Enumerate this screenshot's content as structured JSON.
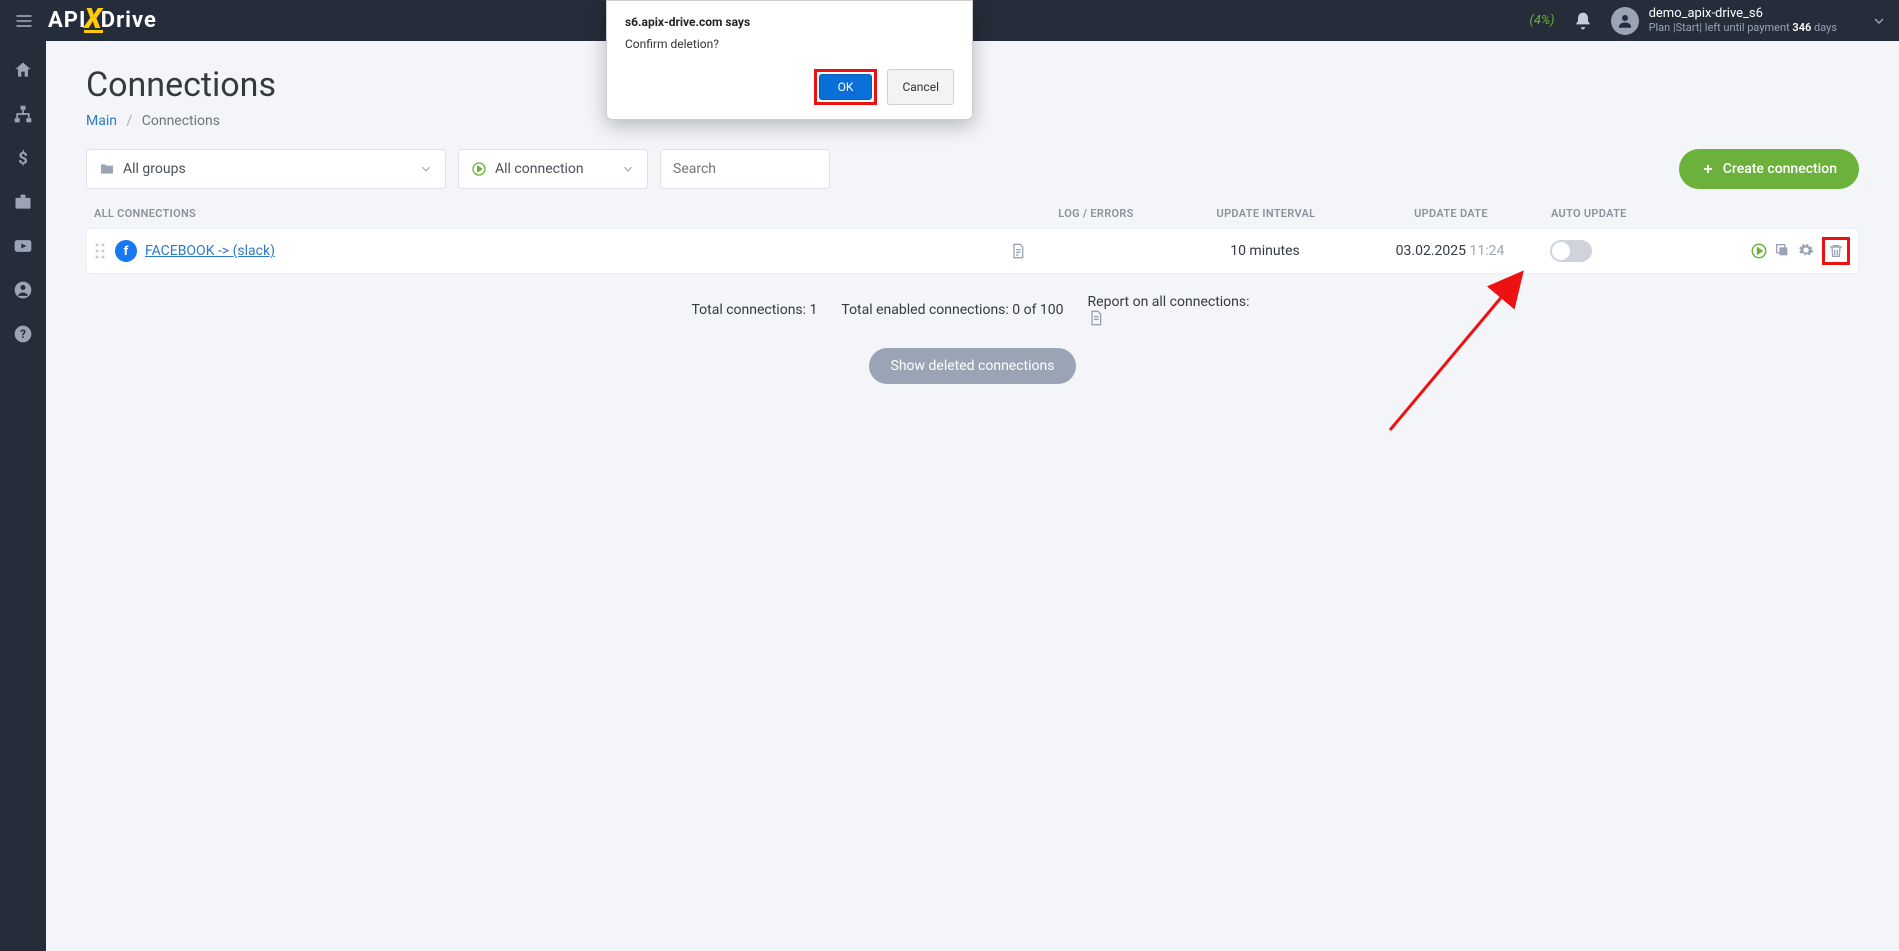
{
  "logo": {
    "part1": "API",
    "part2": "X",
    "part3": "Drive"
  },
  "header": {
    "percent_text": "(4%)",
    "user_name": "demo_apix-drive_s6",
    "plan_prefix": "Plan |Start| left until payment ",
    "plan_days": "346",
    "plan_suffix": " days"
  },
  "page": {
    "title": "Connections",
    "breadcrumb_main": "Main",
    "breadcrumb_current": "Connections"
  },
  "filters": {
    "groups_label": "All groups",
    "status_label": "All connection",
    "search_placeholder": "Search",
    "create_label": "Create connection"
  },
  "table": {
    "head_all": "ALL CONNECTIONS",
    "head_log": "LOG / ERRORS",
    "head_interval": "UPDATE INTERVAL",
    "head_date": "UPDATE DATE",
    "head_auto": "AUTO UPDATE",
    "row": {
      "name": "FACEBOOK -> (slack)",
      "interval": "10 minutes",
      "date": "03.02.2025",
      "time": "11:24"
    }
  },
  "summary": {
    "total_label": "Total connections: 1",
    "enabled_label": "Total enabled connections: 0 of 100",
    "report_label": "Report on all connections:",
    "show_deleted": "Show deleted connections"
  },
  "dialog": {
    "host": "s6.apix-drive.com says",
    "msg": "Confirm deletion?",
    "ok": "OK",
    "cancel": "Cancel"
  }
}
